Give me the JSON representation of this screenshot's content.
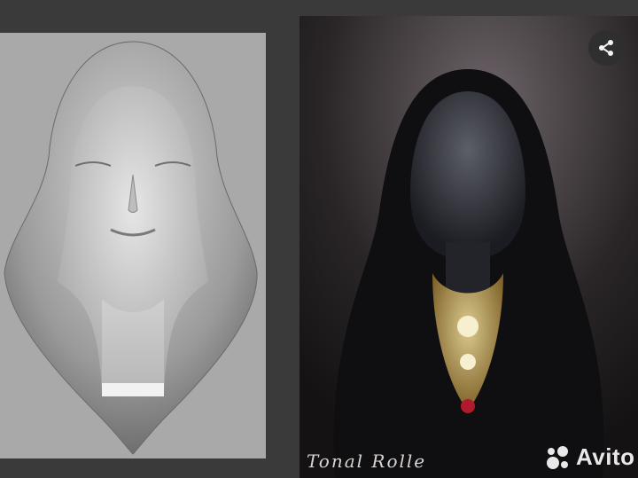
{
  "images": {
    "left": {
      "label": "sculpt-render",
      "bg": "#a9a9a9"
    },
    "right": {
      "label": "hooded-woman-with-necklace",
      "bg": "#1d1b1c"
    }
  },
  "share": {
    "icon": "share-icon"
  },
  "watermark": {
    "text": "Avito"
  },
  "signature": {
    "text": "Tonal Rolle"
  }
}
